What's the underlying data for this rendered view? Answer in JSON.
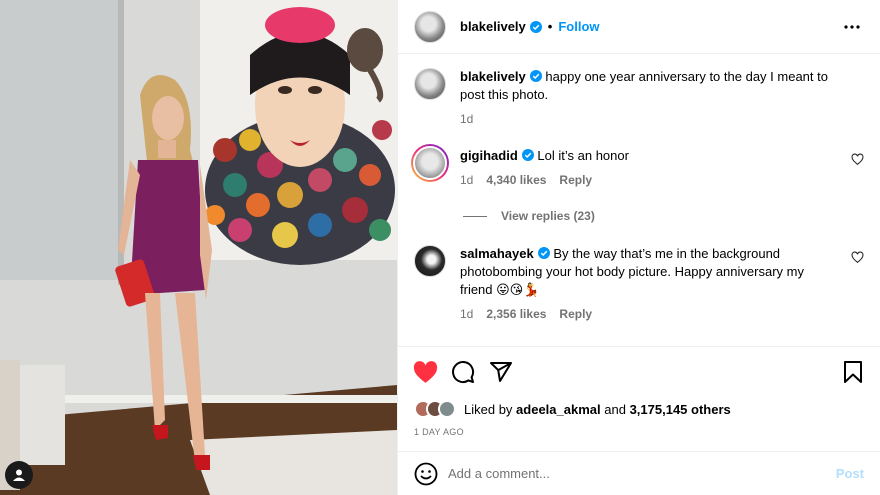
{
  "post": {
    "author": "blakelively",
    "follow_label": "Follow",
    "separator": "•",
    "caption": {
      "username": "blakelively",
      "text": "happy one year anniversary to the day I meant to post this photo.",
      "time": "1d"
    },
    "comments": [
      {
        "username": "gigihadid",
        "text": "Lol it’s an honor",
        "time": "1d",
        "likes": "4,340 likes",
        "reply_label": "Reply",
        "view_replies": "View replies (23)"
      },
      {
        "username": "salmahayek",
        "text": "By the way that’s me in the background photobombing your hot body picture. Happy anniversary my friend 😛😘💃",
        "time": "1d",
        "likes": "2,356 likes",
        "reply_label": "Reply"
      }
    ],
    "liked_by": {
      "prefix": "Liked by",
      "user": "adeela_akmal",
      "conjunction": "and",
      "count": "3,175,145 others"
    },
    "date": "1 DAY AGO",
    "add_comment_placeholder": "Add a comment...",
    "post_button": "Post"
  },
  "icons": {
    "verified": "verified-badge-icon",
    "more": "more-options-icon",
    "heart": "heart-icon",
    "comment": "comment-icon",
    "share": "share-icon",
    "bookmark": "bookmark-icon",
    "emoji": "emoji-icon",
    "user_tag": "user-tag-icon"
  },
  "colors": {
    "accent": "#0095f6",
    "liked_heart": "#ff3040",
    "muted_text": "#737373",
    "post_disabled": "#b2dffc"
  }
}
